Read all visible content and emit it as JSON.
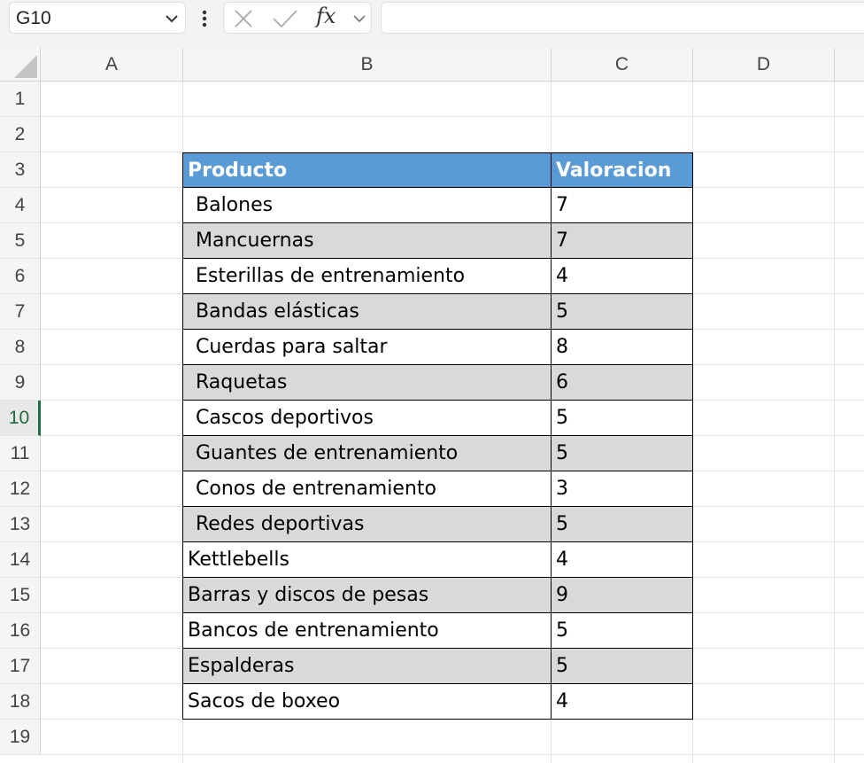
{
  "formula_bar": {
    "name_box": "G10",
    "fx_label": "fx",
    "formula": ""
  },
  "columns": [
    "A",
    "B",
    "C",
    "D"
  ],
  "rows": [
    "1",
    "2",
    "3",
    "4",
    "5",
    "6",
    "7",
    "8",
    "9",
    "10",
    "11",
    "12",
    "13",
    "14",
    "15",
    "16",
    "17",
    "18",
    "19"
  ],
  "active_row": "10",
  "table": {
    "header": {
      "product": "Producto",
      "rating": "Valoracion"
    },
    "rows": [
      {
        "product": "Balones",
        "rating": "7"
      },
      {
        "product": "Mancuernas",
        "rating": "7"
      },
      {
        "product": "Esterillas de entrenamiento",
        "rating": "4"
      },
      {
        "product": "Bandas elásticas",
        "rating": "5"
      },
      {
        "product": "Cuerdas para saltar",
        "rating": "8"
      },
      {
        "product": "Raquetas",
        "rating": "6"
      },
      {
        "product": "Cascos deportivos",
        "rating": "5"
      },
      {
        "product": "Guantes de entrenamiento",
        "rating": "5"
      },
      {
        "product": "Conos de entrenamiento",
        "rating": "3"
      },
      {
        "product": "Redes deportivas",
        "rating": "5"
      },
      {
        "product": "Kettlebells",
        "rating": "4"
      },
      {
        "product": "Barras y discos de pesas",
        "rating": "9"
      },
      {
        "product": "Bancos de entrenamiento",
        "rating": "5"
      },
      {
        "product": "Espalderas",
        "rating": "5"
      },
      {
        "product": "Sacos de boxeo",
        "rating": "4"
      }
    ]
  },
  "colors": {
    "header_fill": "#5b9bd5",
    "band_fill": "#d9d9d9",
    "active_row_accent": "#1e7145"
  }
}
